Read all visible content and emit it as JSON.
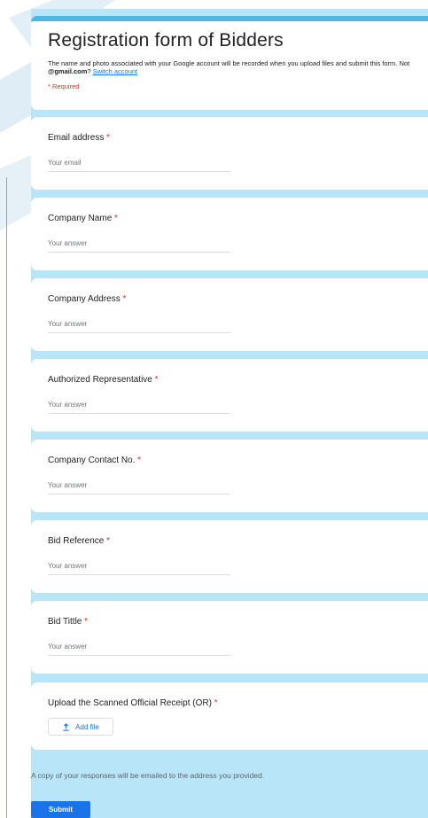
{
  "form": {
    "title": "Registration form of Bidders",
    "description_part1": "The name and photo associated with your Google account will be recorded when you upload files and submit this form. Not ",
    "account_email": "@gmail.com",
    "description_part2": "? ",
    "switch_account_label": "Switch account",
    "required_note": "* Required"
  },
  "questions": [
    {
      "label": "Email address",
      "required_mark": "*",
      "placeholder": "Your email"
    },
    {
      "label": "Company Name",
      "required_mark": "*",
      "placeholder": "Your answer"
    },
    {
      "label": "Company Address",
      "required_mark": "*",
      "placeholder": "Your answer"
    },
    {
      "label": "Authorized Representative",
      "required_mark": "*",
      "placeholder": "Your answer"
    },
    {
      "label": "Company Contact No.",
      "required_mark": "*",
      "placeholder": "Your answer"
    },
    {
      "label": "Bid Reference",
      "required_mark": "*",
      "placeholder": "Your answer"
    },
    {
      "label": "Bid Tittle",
      "required_mark": "*",
      "placeholder": "Your answer"
    }
  ],
  "upload": {
    "label": "Upload the Scanned Official Receipt (OR)",
    "required_mark": "*",
    "button_label": "Add file",
    "icon": "upload-icon"
  },
  "footer": {
    "copy_note": "A copy of your responses will be emailed to the address you provided.",
    "submit_label": "Submit"
  },
  "colors": {
    "accent": "#4bb7e6",
    "background": "#b8e6f8",
    "required": "#d93025",
    "link": "#1a73e8"
  }
}
